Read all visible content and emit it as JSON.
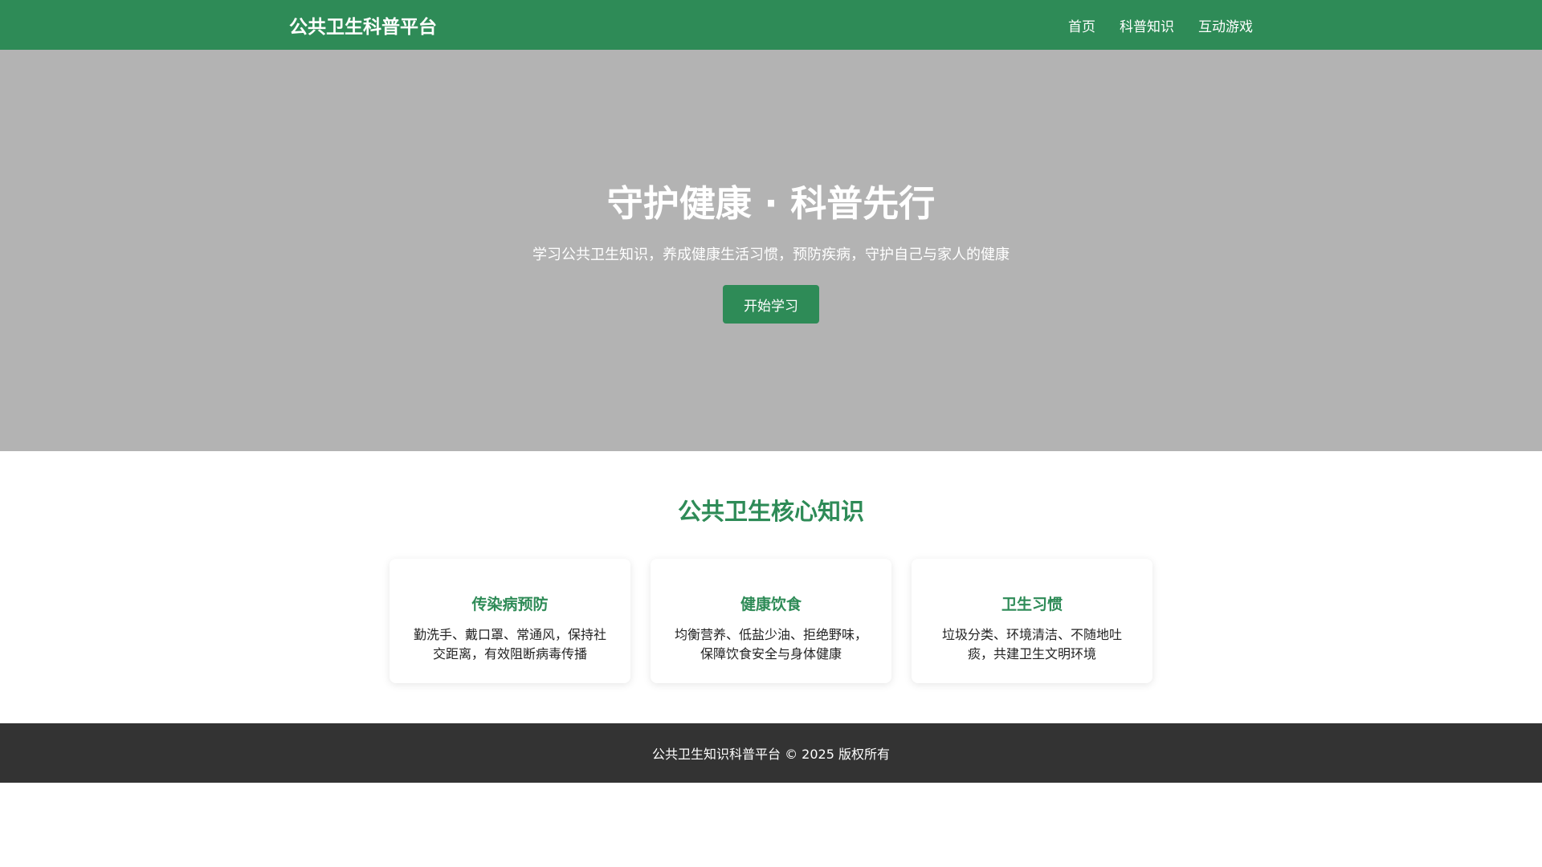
{
  "nav": {
    "logo": "公共卫生科普平台",
    "links": [
      "首页",
      "科普知识",
      "互动游戏"
    ]
  },
  "hero": {
    "title": "守护健康 · 科普先行",
    "subtitle": "学习公共卫生知识，养成健康生活习惯，预防疾病，守护自己与家人的健康",
    "button": "开始学习"
  },
  "section": {
    "title": "公共卫生核心知识",
    "cards": [
      {
        "title": "传染病预防",
        "text": "勤洗手、戴口罩、常通风，保持社交距离，有效阻断病毒传播"
      },
      {
        "title": "健康饮食",
        "text": "均衡营养、低盐少油、拒绝野味，保障饮食安全与身体健康"
      },
      {
        "title": "卫生习惯",
        "text": "垃圾分类、环境清洁、不随地吐痰，共建卫生文明环境"
      }
    ]
  },
  "footer": {
    "text": "公共卫生知识科普平台 © 2025 版权所有"
  }
}
